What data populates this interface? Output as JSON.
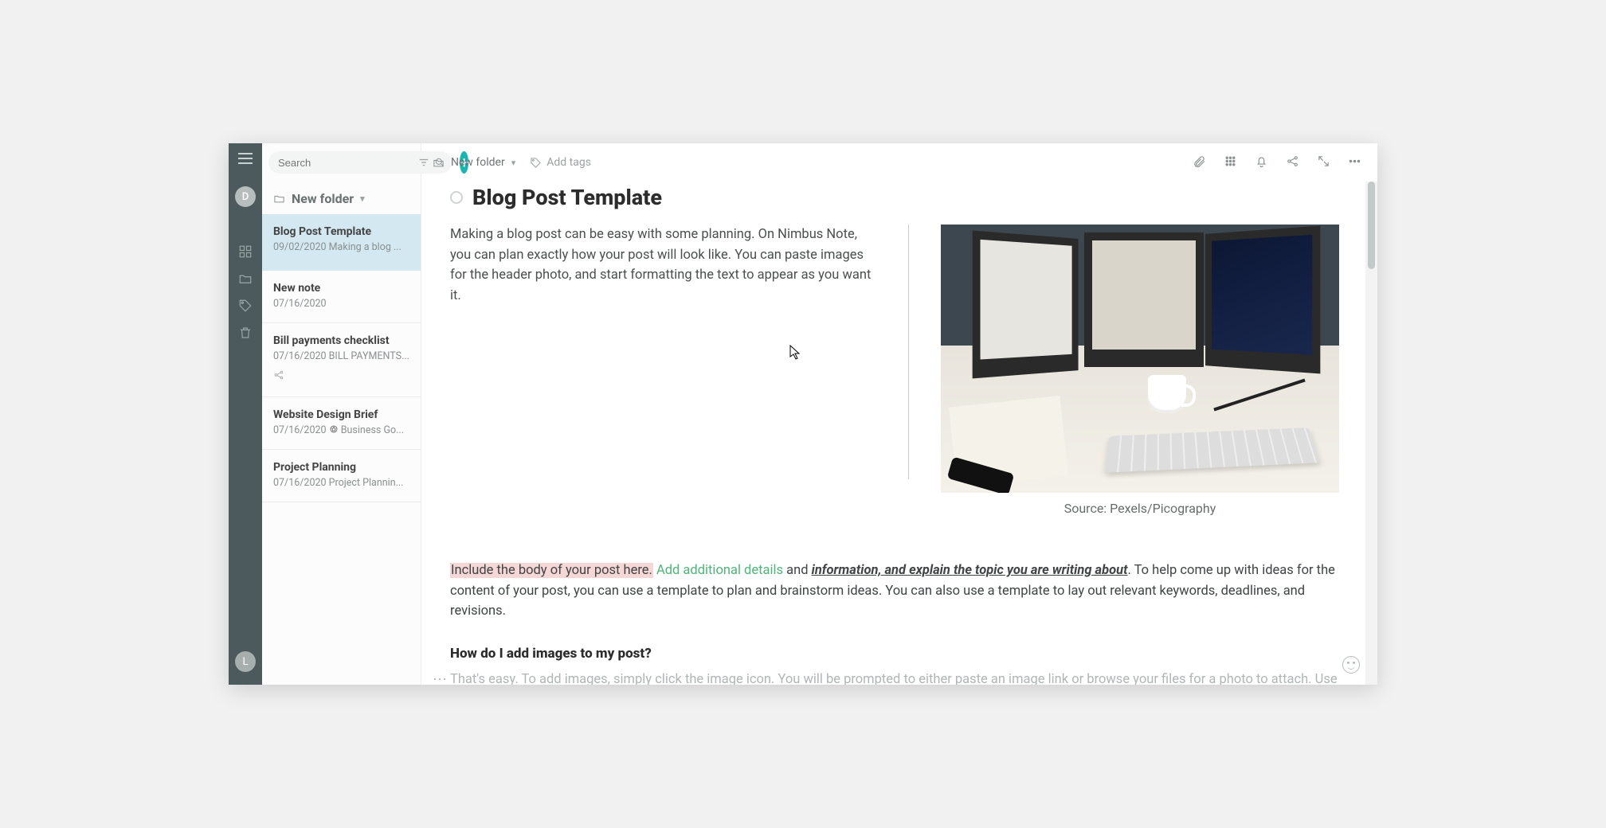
{
  "rail": {
    "avatar_top": "D",
    "avatar_bottom": "L"
  },
  "sidebar": {
    "search_placeholder": "Search",
    "folder_label": "New folder",
    "items": [
      {
        "title": "Blog Post Template",
        "date": "09/02/2020",
        "preview": "Making a blog ...",
        "selected": true
      },
      {
        "title": "New note",
        "date": "07/16/2020",
        "preview": ""
      },
      {
        "title": "Bill payments checklist",
        "date": "07/16/2020",
        "preview": "BILL PAYMENTS...",
        "shared": true
      },
      {
        "title": "Website Design Brief",
        "date": "07/16/2020",
        "preview": "Business Go...",
        "icon": "soccer"
      },
      {
        "title": "Project Planning",
        "date": "07/16/2020",
        "preview": "Project Plannin..."
      }
    ]
  },
  "toolbar": {
    "breadcrumb": "New folder",
    "add_tags": "Add tags"
  },
  "doc": {
    "title": "Blog Post Template",
    "intro": "Making a blog post can be easy with some planning. On Nimbus Note, you can plan exactly how your post will look like. You can paste images for the header photo, and start formatting the text to appear as you want it.",
    "caption": "Source: Pexels/Picography",
    "body_seg1": "Include the body of your post here.",
    "body_seg2": " Add additional details",
    "body_seg3": " and ",
    "body_seg4": "information, and explain the topic you are writing about",
    "body_seg5": ". To help come up with ideas for the content of your post, you can use a template to plan and brainstorm ideas. You can also use a template to lay out relevant keywords, deadlines, and revisions.",
    "subhead": "How do I add images to my post?",
    "faded": "That's easy. To add images, simply click the image icon. You will be prompted to either paste an image link or browse your files for a photo to attach. Use clear images"
  }
}
